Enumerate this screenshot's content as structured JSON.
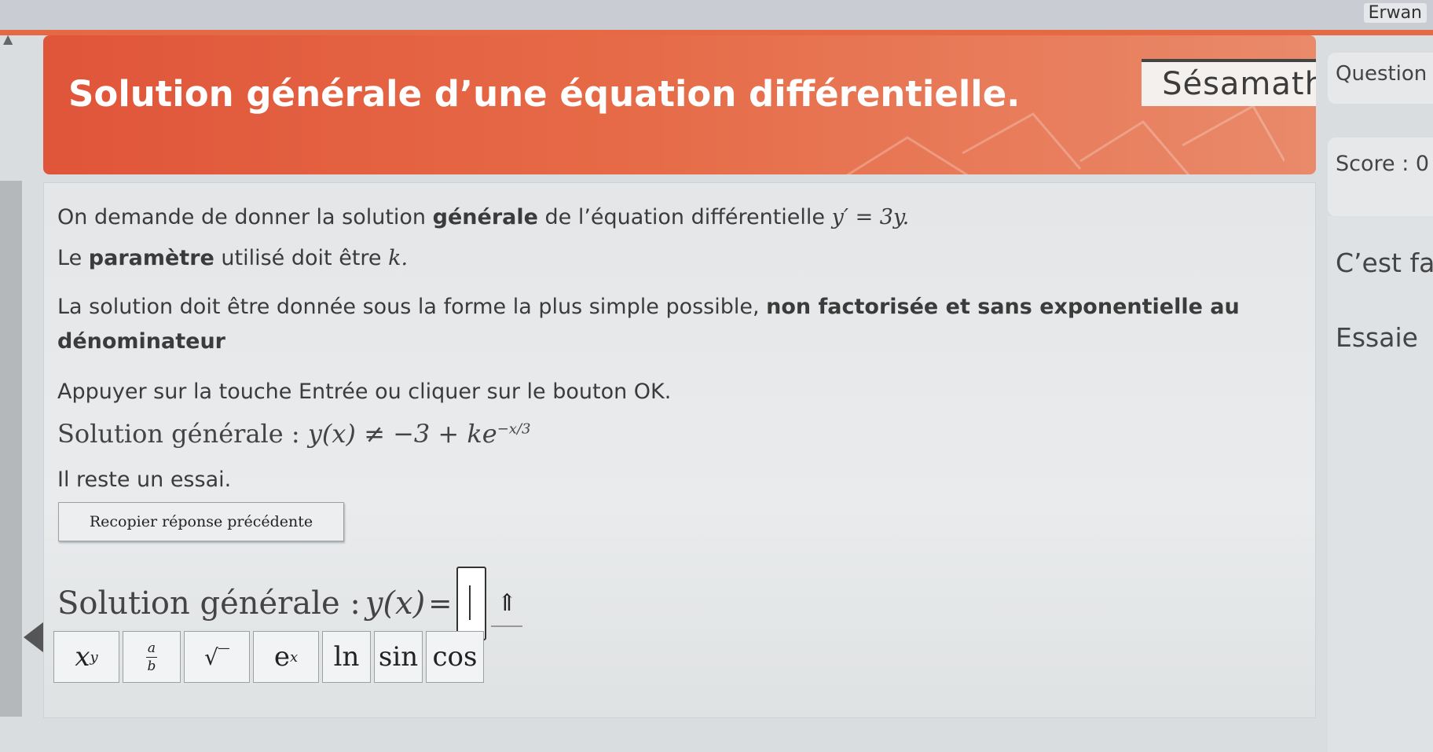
{
  "user": {
    "name": "Erwan"
  },
  "banner": {
    "title": "Solution générale d’une équation différentielle.",
    "logo": "Sésamath"
  },
  "sidebar": {
    "question_label": "Question",
    "score_label": "Score : 0",
    "feedback_line1": "C’est fa",
    "feedback_line2": "Essaie"
  },
  "statement": {
    "line1_a": "On demande de donner la solution ",
    "line1_b": "générale",
    "line1_c": " de l’équation différentielle ",
    "line1_math": "y′ = 3y.",
    "line2_a": "Le ",
    "line2_b": "paramètre",
    "line2_c": " utilisé doit être ",
    "line2_math": "k.",
    "line3_a": "La solution doit être donnée sous la forme la plus simple possible, ",
    "line3_b": "non factorisée et sans exponentielle au",
    "line4_b": "dénominateur",
    "line5": "Appuyer sur la touche Entrée ou cliquer sur le bouton OK."
  },
  "previous_attempt": {
    "label": "Solution générale : ",
    "expr_main": "y(x) ≠ −3 + ke",
    "expr_exp": "−x/3"
  },
  "attempts_text": "Il reste un essai.",
  "copy_button_label": "Recopier réponse précédente",
  "answer": {
    "label": "Solution générale : ",
    "lhs": "y(x)",
    "eq": "=",
    "up_symbol": "⇑"
  },
  "keypad": {
    "xy_base": "x",
    "xy_exp": "y",
    "frac_num": "a",
    "frac_den": "b",
    "sqrt": "√‾",
    "exp_base": "e",
    "exp_exp": "x",
    "ln": "ln",
    "sin": "sin",
    "cos": "cos"
  }
}
